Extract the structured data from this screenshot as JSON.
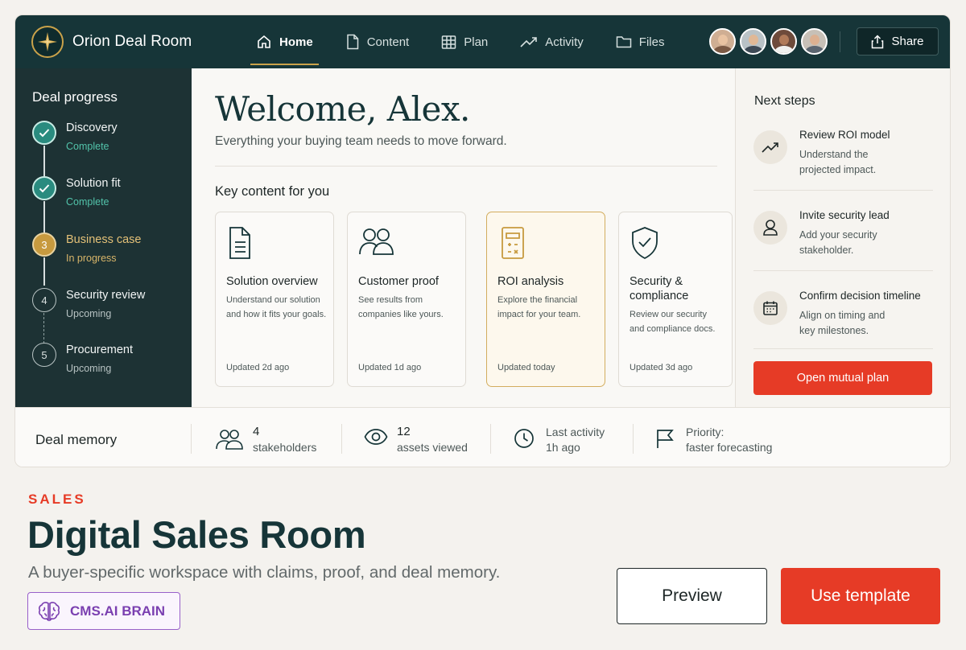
{
  "app": {
    "name": "Orion Deal Room",
    "logo_icon": "compass-star-icon"
  },
  "nav": {
    "items": [
      {
        "label": "Home",
        "icon": "home-icon",
        "active": true
      },
      {
        "label": "Content",
        "icon": "document-icon",
        "active": false
      },
      {
        "label": "Plan",
        "icon": "table-icon",
        "active": false
      },
      {
        "label": "Activity",
        "icon": "trend-icon",
        "active": false
      },
      {
        "label": "Files",
        "icon": "folder-icon",
        "active": false
      }
    ],
    "share_label": "Share"
  },
  "sidebar": {
    "title": "Deal progress",
    "steps": [
      {
        "label": "Discovery",
        "status": "Complete",
        "state": "done"
      },
      {
        "label": "Solution fit",
        "status": "Complete",
        "state": "done"
      },
      {
        "number": "3",
        "label": "Business case",
        "status": "In progress",
        "state": "current"
      },
      {
        "number": "4",
        "label": "Security review",
        "status": "Upcoming",
        "state": "upcoming"
      },
      {
        "number": "5",
        "label": "Procurement",
        "status": "Upcoming",
        "state": "upcoming"
      }
    ]
  },
  "main": {
    "welcome": "Welcome, Alex.",
    "subtitle": "Everything your buying team needs to move forward.",
    "key_title": "Key content for you",
    "cards": [
      {
        "title": "Solution overview",
        "desc_lines": [
          "Understand our solution",
          "and how it fits your goals."
        ],
        "updated": "Updated 2d ago",
        "icon": "document-icon"
      },
      {
        "title": "Customer proof",
        "desc_lines": [
          "See results from",
          "companies like yours."
        ],
        "updated": "Updated 1d ago",
        "icon": "users-icon"
      },
      {
        "title": "ROI analysis",
        "desc_lines": [
          "Explore the financial",
          "impact for your team."
        ],
        "updated": "Updated today",
        "icon": "calculator-icon"
      },
      {
        "title_lines": [
          "Security &",
          "compliance"
        ],
        "desc_lines": [
          "Review our security",
          "and compliance docs."
        ],
        "updated": "Updated 3d ago",
        "icon": "shield-check-icon"
      }
    ]
  },
  "next_steps": {
    "title": "Next steps",
    "items": [
      {
        "title": "Review ROI model",
        "sub_lines": [
          "Understand the",
          "projected impact."
        ],
        "icon": "trend-icon"
      },
      {
        "title": "Invite security lead",
        "sub_lines": [
          "Add your security",
          "stakeholder."
        ],
        "icon": "user-icon"
      },
      {
        "title": "Confirm decision timeline",
        "sub_lines": [
          "Align on timing and",
          "key milestones."
        ],
        "icon": "calendar-icon"
      }
    ],
    "button": "Open mutual plan"
  },
  "memory": {
    "title": "Deal memory",
    "stakeholders_value": "4",
    "stakeholders_label": "stakeholders",
    "assets_value": "12",
    "assets_label": "assets viewed",
    "activity_label": "Last activity",
    "activity_value": "1h ago",
    "priority_label": "Priority:",
    "priority_value": "faster forecasting"
  },
  "hero": {
    "category": "SALES",
    "title": "Digital Sales Room",
    "subtitle": "A buyer-specific workspace with claims, proof, and deal memory.",
    "badge": "CMS.AI BRAIN",
    "preview": "Preview",
    "use_template": "Use template"
  },
  "colors": {
    "topbar": "#163538",
    "sidebar": "#1d3234",
    "accent_red": "#e63b26",
    "accent_gold": "#c79a3f",
    "accent_teal": "#2a8b7f",
    "badge_purple": "#7a3fb0"
  }
}
